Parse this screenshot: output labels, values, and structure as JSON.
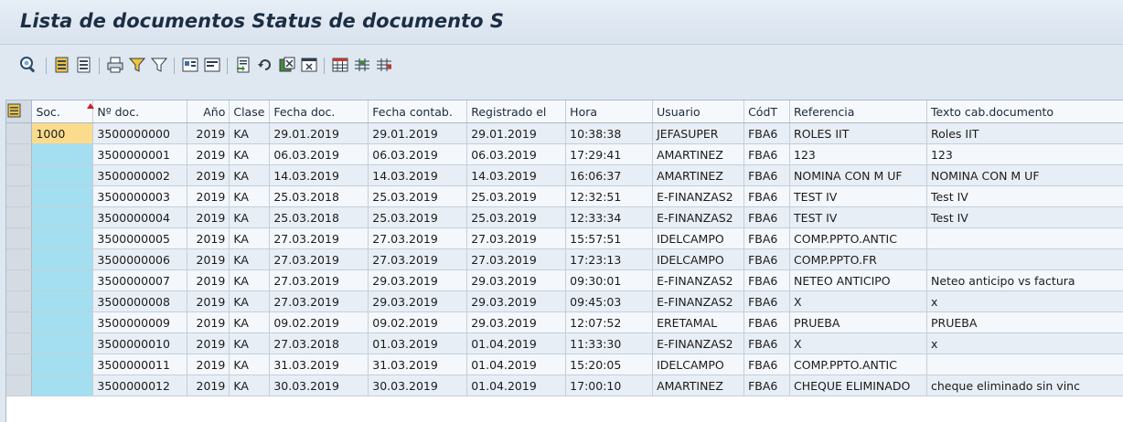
{
  "window": {
    "title": "Lista de documentos Status de documento S"
  },
  "toolbar": {
    "buttons": [
      "details-icon",
      "select-all-icon",
      "deselect-all-icon",
      "print-icon",
      "filter-icon",
      "filter-off-icon",
      "expand-icon",
      "collapse-icon",
      "export-icon",
      "refresh-icon",
      "spreadsheet-icon",
      "layout-icon",
      "choose-layout-icon",
      "save-layout-icon",
      "manage-layout-icon"
    ]
  },
  "table": {
    "columns": [
      "Soc.",
      "Nº doc.",
      "Año",
      "Clase",
      "Fecha doc.",
      "Fecha contab.",
      "Registrado el",
      "Hora",
      "Usuario",
      "CódT",
      "Referencia",
      "Texto cab.documento"
    ],
    "rows": [
      [
        "1000",
        "3500000000",
        "2019",
        "KA",
        "29.01.2019",
        "29.01.2019",
        "29.01.2019",
        "10:38:38",
        "JEFASUPER",
        "FBA6",
        "ROLES IIT",
        "Roles IIT"
      ],
      [
        "",
        "3500000001",
        "2019",
        "KA",
        "06.03.2019",
        "06.03.2019",
        "06.03.2019",
        "17:29:41",
        "AMARTINEZ",
        "FBA6",
        "123",
        "123"
      ],
      [
        "",
        "3500000002",
        "2019",
        "KA",
        "14.03.2019",
        "14.03.2019",
        "14.03.2019",
        "16:06:37",
        "AMARTINEZ",
        "FBA6",
        "NOMINA CON M UF",
        "NOMINA CON M UF"
      ],
      [
        "",
        "3500000003",
        "2019",
        "KA",
        "25.03.2018",
        "25.03.2019",
        "25.03.2019",
        "12:32:51",
        "E-FINANZAS2",
        "FBA6",
        "TEST IV",
        "Test IV"
      ],
      [
        "",
        "3500000004",
        "2019",
        "KA",
        "25.03.2018",
        "25.03.2019",
        "25.03.2019",
        "12:33:34",
        "E-FINANZAS2",
        "FBA6",
        "TEST IV",
        "Test IV"
      ],
      [
        "",
        "3500000005",
        "2019",
        "KA",
        "27.03.2019",
        "27.03.2019",
        "27.03.2019",
        "15:57:51",
        "IDELCAMPO",
        "FBA6",
        "COMP.PPTO.ANTIC",
        ""
      ],
      [
        "",
        "3500000006",
        "2019",
        "KA",
        "27.03.2019",
        "27.03.2019",
        "27.03.2019",
        "17:23:13",
        "IDELCAMPO",
        "FBA6",
        "COMP.PPTO.FR",
        ""
      ],
      [
        "",
        "3500000007",
        "2019",
        "KA",
        "27.03.2019",
        "29.03.2019",
        "29.03.2019",
        "09:30:01",
        "E-FINANZAS2",
        "FBA6",
        "NETEO ANTICIPO",
        "Neteo anticipo vs factura"
      ],
      [
        "",
        "3500000008",
        "2019",
        "KA",
        "27.03.2019",
        "29.03.2019",
        "29.03.2019",
        "09:45:03",
        "E-FINANZAS2",
        "FBA6",
        "X",
        "x"
      ],
      [
        "",
        "3500000009",
        "2019",
        "KA",
        "09.02.2019",
        "09.02.2019",
        "29.03.2019",
        "12:07:52",
        "ERETAMAL",
        "FBA6",
        "PRUEBA",
        "PRUEBA"
      ],
      [
        "",
        "3500000010",
        "2019",
        "KA",
        "27.03.2018",
        "01.03.2019",
        "01.04.2019",
        "11:33:30",
        "E-FINANZAS2",
        "FBA6",
        "X",
        "x"
      ],
      [
        "",
        "3500000011",
        "2019",
        "KA",
        "31.03.2019",
        "31.03.2019",
        "01.04.2019",
        "15:20:05",
        "IDELCAMPO",
        "FBA6",
        "COMP.PPTO.ANTIC",
        ""
      ],
      [
        "",
        "3500000012",
        "2019",
        "KA",
        "30.03.2019",
        "30.03.2019",
        "01.04.2019",
        "17:00:10",
        "AMARTINEZ",
        "FBA6",
        "CHEQUE ELIMINADO",
        "cheque eliminado sin vinc"
      ]
    ]
  },
  "colors": {
    "key_column": "#a3dff0",
    "selected_cell": "#fbdc8c",
    "row_even": "#e8eef5",
    "row_odd": "#f4f7fb",
    "header_bg": "#f6f9fc",
    "sort_indicator": "#d21b2b"
  }
}
